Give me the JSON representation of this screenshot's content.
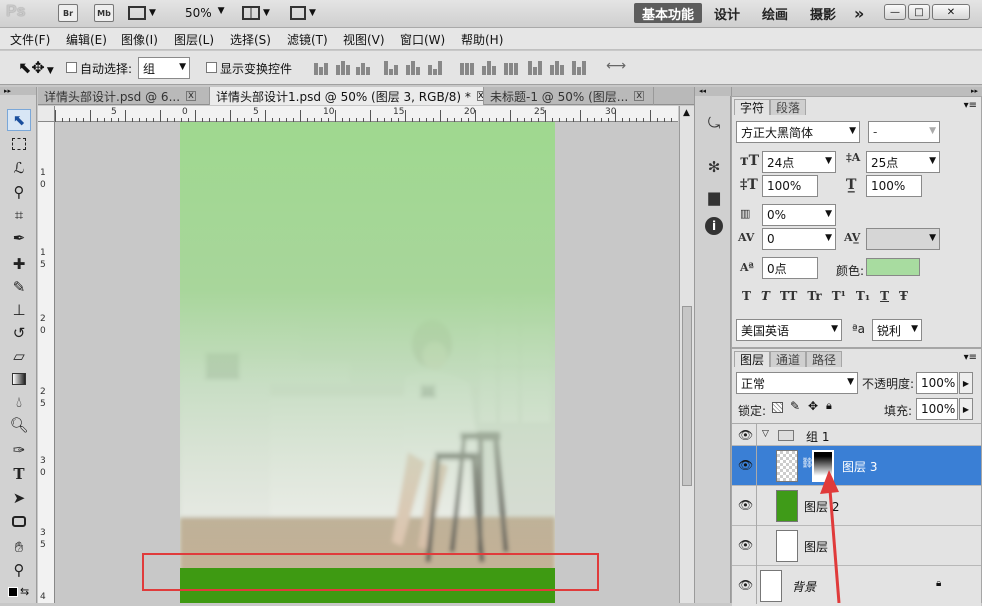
{
  "app": {
    "logo": "Ps",
    "mini_buttons": [
      "Br",
      "Mb"
    ],
    "zoom": "50%",
    "workspaces": [
      "基本功能",
      "设计",
      "绘画",
      "摄影"
    ],
    "more": "»"
  },
  "menu": [
    "文件(F)",
    "编辑(E)",
    "图像(I)",
    "图层(L)",
    "选择(S)",
    "滤镜(T)",
    "视图(V)",
    "窗口(W)",
    "帮助(H)"
  ],
  "options": {
    "auto_select_label": "自动选择:",
    "auto_select_value": "组",
    "show_transform_label": "显示变换控件"
  },
  "tabs": [
    {
      "label": "详情头部设计.psd @ 6...",
      "active": false
    },
    {
      "label": "详情头部设计1.psd @ 50% (图层 3, RGB/8) *",
      "active": true
    },
    {
      "label": "未标题-1 @ 50% (图层...",
      "active": false
    }
  ],
  "ruler": {
    "h_labels": [
      "5",
      "0",
      "5",
      "10",
      "15",
      "20",
      "25",
      "30"
    ],
    "v_labels": [
      "1",
      "0",
      "1",
      "5",
      "2",
      "0",
      "2",
      "5",
      "3",
      "0",
      "3",
      "5",
      "4"
    ]
  },
  "character": {
    "tabs": [
      "字符",
      "段落"
    ],
    "font_family": "方正大黑简体",
    "font_style": "-",
    "font_size": "24点",
    "leading": "25点",
    "vscale": "100%",
    "hscale": "100%",
    "tsume": "0%",
    "kerning": "0",
    "tracking": "",
    "baseline": "0点",
    "color_label": "颜色:",
    "color": "#a8dca0",
    "style_buttons": [
      "T",
      "T",
      "TT",
      "Tr",
      "T¹",
      "T₁",
      "T",
      "Ŧ"
    ],
    "language": "美国英语",
    "aa_label": "ªa",
    "antialias": "锐利"
  },
  "layers": {
    "tabs": [
      "图层",
      "通道",
      "路径"
    ],
    "blend_mode": "正常",
    "opacity_label": "不透明度:",
    "opacity": "100%",
    "lock_label": "锁定:",
    "fill_label": "填充:",
    "fill": "100%",
    "group_name": "组 1",
    "items": [
      {
        "name": "图层 3",
        "selected": true
      },
      {
        "name": "图层 2",
        "selected": false
      },
      {
        "name": "图层",
        "selected": false
      },
      {
        "name": "背景",
        "selected": false
      }
    ]
  }
}
